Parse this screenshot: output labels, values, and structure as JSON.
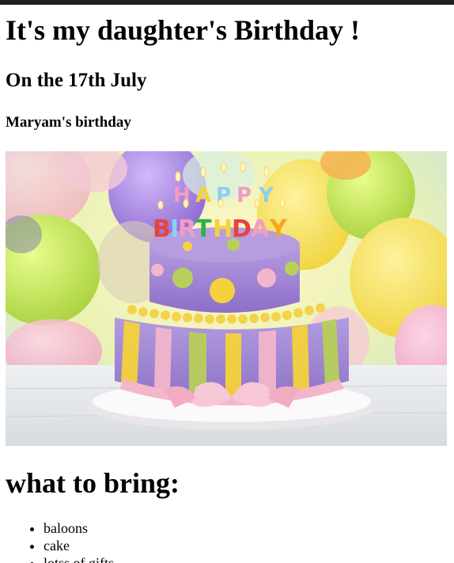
{
  "page": {
    "title": "It's my daughter's Birthday !",
    "date_heading": "On the 17th July",
    "name_heading": "Maryam's birthday",
    "image": {
      "alt_icon": "birthday-cake-image",
      "cake_topper": {
        "line1": "HAPPY",
        "line2": "BIRTHDAY"
      }
    },
    "bring_heading": "what to bring:",
    "bring_items": [
      "baloons",
      "cake",
      "lotss of gifts"
    ]
  },
  "colors": {
    "top_bar": "#1f1f1f",
    "text": "#000000",
    "cake_purple": "#a98fd0",
    "cake_pink": "#f3b5cc",
    "cake_yellow": "#f5d23c",
    "cake_green": "#b8cf5a"
  }
}
